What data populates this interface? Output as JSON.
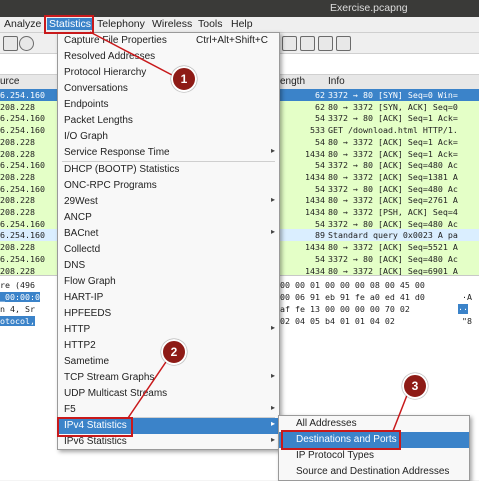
{
  "window": {
    "title": "Exercise.pcapng"
  },
  "menubar": {
    "items": [
      "Analyze",
      "Statistics",
      "Telephony",
      "Wireless",
      "Tools",
      "Help"
    ]
  },
  "packet_list": {
    "columns": {
      "source": "urce",
      "length": "ength",
      "info": "Info"
    },
    "rows": [
      {
        "src": "6.254.160",
        "len": "62",
        "info": "3372 → 80 [SYN] Seq=0 Win=",
        "style": "sel"
      },
      {
        "src": "208.228",
        "len": "62",
        "info": "80 → 3372 [SYN, ACK] Seq=0",
        "style": "green"
      },
      {
        "src": "6.254.160",
        "len": "54",
        "info": "3372 → 80 [ACK] Seq=1 Ack=",
        "style": "green"
      },
      {
        "src": "6.254.160",
        "len": "533",
        "info": "GET /download.html HTTP/1.",
        "style": "green"
      },
      {
        "src": "208.228",
        "len": "54",
        "info": "80 → 3372 [ACK] Seq=1 Ack=",
        "style": "green"
      },
      {
        "src": "208.228",
        "len": "1434",
        "info": "80 → 3372 [ACK] Seq=1 Ack=",
        "style": "green"
      },
      {
        "src": "6.254.160",
        "len": "54",
        "info": "3372 → 80 [ACK] Seq=480 Ac",
        "style": "green"
      },
      {
        "src": "208.228",
        "len": "1434",
        "info": "80 → 3372 [ACK] Seq=1381 A",
        "style": "green"
      },
      {
        "src": "6.254.160",
        "len": "54",
        "info": "3372 → 80 [ACK] Seq=480 Ac",
        "style": "green"
      },
      {
        "src": "208.228",
        "len": "1434",
        "info": "80 → 3372 [ACK] Seq=2761 A",
        "style": "green"
      },
      {
        "src": "208.228",
        "len": "1434",
        "info": "80 → 3372 [PSH, ACK] Seq=4",
        "style": "green"
      },
      {
        "src": "6.254.160",
        "len": "54",
        "info": "3372 → 80 [ACK] Seq=480 Ac",
        "style": "green"
      },
      {
        "src": "6.254.160",
        "len": "89",
        "info": "Standard query 0x0023 A pa",
        "style": "blue"
      },
      {
        "src": "208.228",
        "len": "1434",
        "info": "80 → 3372 [ACK] Seq=5521 A",
        "style": "green"
      },
      {
        "src": "6.254.160",
        "len": "54",
        "info": "3372 → 80 [ACK] Seq=480 Ac",
        "style": "green"
      },
      {
        "src": "208.228",
        "len": "1434",
        "info": "80 → 3372 [ACK] Seq=6901 A",
        "style": "green"
      }
    ]
  },
  "detail": {
    "left": [
      "re (496",
      "_00:00:0",
      "n 4, Sr",
      "otocol,"
    ],
    "hex": [
      "00 00 01 00 00 00 08 00 45 00",
      "00 06 91 eb 91 fe a0 ed 41 d0",
      "af fe 13 00 00 00 00 70 02",
      "02 04 05 b4 01 01 04 02"
    ],
    "ascii": [
      "",
      "·A",
      "··",
      "\"8"
    ]
  },
  "statistics_menu": {
    "items": [
      {
        "label": "Capture File Properties",
        "shortcut": "Ctrl+Alt+Shift+C",
        "submenu": false
      },
      {
        "label": "Resolved Addresses",
        "submenu": false
      },
      {
        "label": "Protocol Hierarchy",
        "submenu": false
      },
      {
        "label": "Conversations",
        "submenu": false
      },
      {
        "label": "Endpoints",
        "submenu": false
      },
      {
        "label": "Packet Lengths",
        "submenu": false
      },
      {
        "label": "I/O Graph",
        "submenu": false
      },
      {
        "label": "Service Response Time",
        "submenu": true
      },
      {
        "label": "DHCP (BOOTP) Statistics",
        "submenu": false
      },
      {
        "label": "ONC-RPC Programs",
        "submenu": false
      },
      {
        "label": "29West",
        "submenu": true
      },
      {
        "label": "ANCP",
        "submenu": false
      },
      {
        "label": "BACnet",
        "submenu": true
      },
      {
        "label": "Collectd",
        "submenu": false
      },
      {
        "label": "DNS",
        "submenu": false
      },
      {
        "label": "Flow Graph",
        "submenu": false
      },
      {
        "label": "HART-IP",
        "submenu": false
      },
      {
        "label": "HPFEEDS",
        "submenu": false
      },
      {
        "label": "HTTP",
        "submenu": true
      },
      {
        "label": "HTTP2",
        "submenu": false
      },
      {
        "label": "Sametime",
        "submenu": false
      },
      {
        "label": "TCP Stream Graphs",
        "submenu": true
      },
      {
        "label": "UDP Multicast Streams",
        "submenu": false
      },
      {
        "label": "F5",
        "submenu": true
      },
      {
        "label": "IPv4 Statistics",
        "submenu": true
      },
      {
        "label": "IPv6 Statistics",
        "submenu": true
      }
    ]
  },
  "ipv4_submenu": {
    "items": [
      "All Addresses",
      "Destinations and Ports",
      "IP Protocol Types",
      "Source and Destination Addresses"
    ]
  },
  "annotations": {
    "step1": "1",
    "step2": "2",
    "step3": "3"
  },
  "colors": {
    "accent": "#3b83c9",
    "annotation_red": "#c8191b",
    "badge": "#8e1b16",
    "row_green": "#e4ffc7"
  }
}
